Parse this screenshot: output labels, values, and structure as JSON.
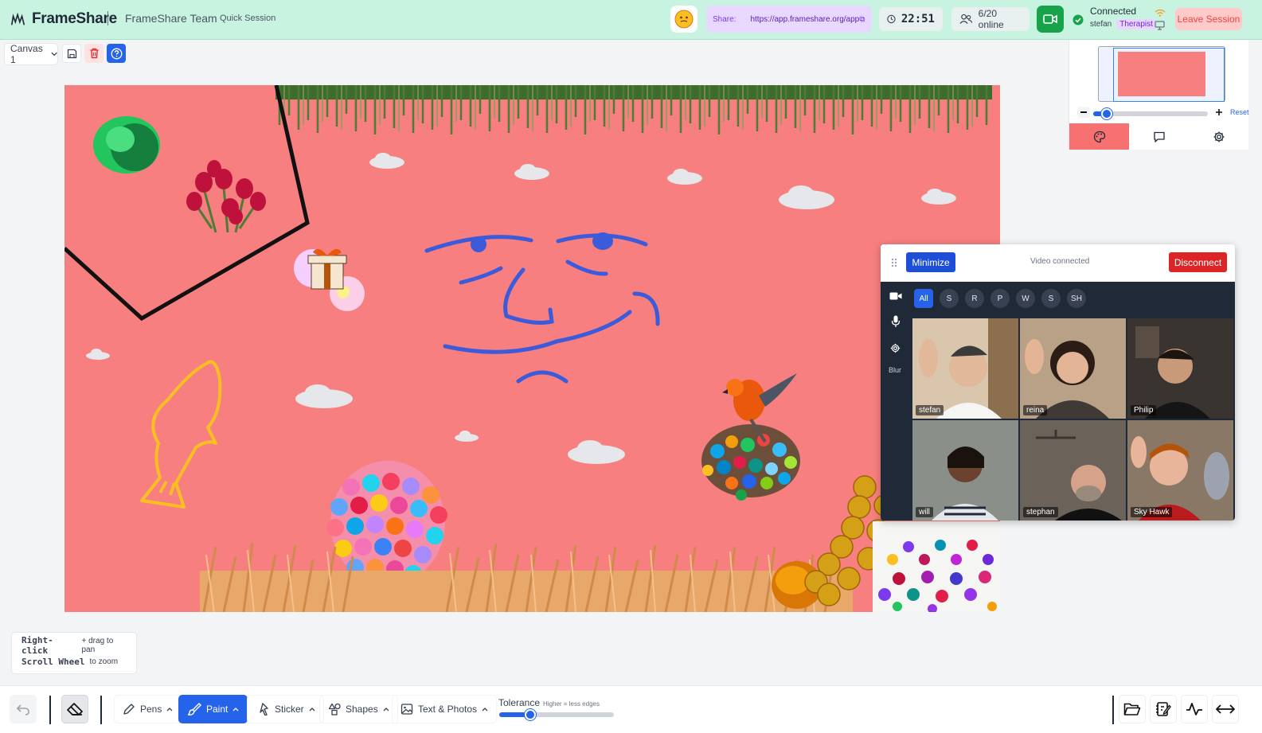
{
  "header": {
    "app_name": "FrameShare",
    "team": "FrameShare Team",
    "session_type": "Quick Session",
    "share_label": "Share:",
    "share_url": "https://app.frameshare.org/app",
    "timer": "22:51",
    "online": "6/20 online",
    "status": "Connected",
    "user": "stefan",
    "role": "Therapist",
    "leave_label": "Leave Session"
  },
  "toolbar_top": {
    "canvas_select": "Canvas 1"
  },
  "minimap": {
    "reset_label": "Reset",
    "zoom_level": 0.12,
    "tabs": [
      "palette-icon",
      "chat-icon",
      "gear-icon"
    ]
  },
  "video": {
    "minimize_label": "Minimize",
    "status": "Video connected",
    "disconnect_label": "Disconnect",
    "blur_label": "Blur",
    "filter_tabs": [
      "All",
      "S",
      "R",
      "P",
      "W",
      "S",
      "SH"
    ],
    "participants": [
      {
        "name": "stefan",
        "bg": "#d9c6ad"
      },
      {
        "name": "reina",
        "bg": "#b9a188"
      },
      {
        "name": "Philip",
        "bg": "#3a3430"
      },
      {
        "name": "will",
        "bg": "#8a8f8a"
      },
      {
        "name": "stephan",
        "bg": "#6b6259"
      },
      {
        "name": "Sky Hawk",
        "bg": "#8a7866"
      }
    ]
  },
  "hints": {
    "key1": "Right-click",
    "desc1": "+ drag to pan",
    "key2": "Scroll Wheel",
    "desc2": "to zoom"
  },
  "bottom_toolbar": {
    "tools": [
      "Pens",
      "Paint",
      "Sticker",
      "Shapes",
      "Text & Photos"
    ],
    "active_tool": "Paint",
    "tolerance_label": "Tolerance",
    "tolerance_hint": "Higher = less edges",
    "tolerance_value": 0.27
  },
  "colors": {
    "header_bg": "#c8f3e1",
    "canvas_bg": "#f77f7f",
    "accent": "#2563eb",
    "danger": "#dc2626"
  }
}
